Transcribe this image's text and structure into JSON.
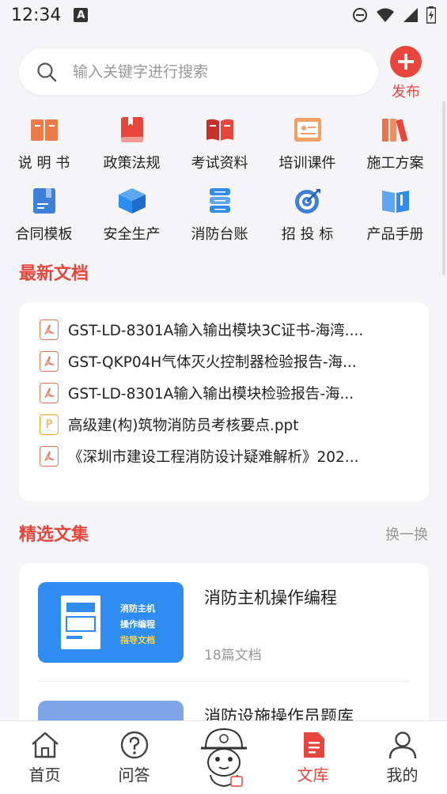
{
  "status": {
    "time": "12:34",
    "badge": "A"
  },
  "search": {
    "placeholder": "输入关键字进行搜索"
  },
  "publish": {
    "label": "发布"
  },
  "categories": [
    {
      "label": "说 明 书",
      "icon": "book-icon"
    },
    {
      "label": "政策法规",
      "icon": "bookmark-book-icon"
    },
    {
      "label": "考试资料",
      "icon": "open-book-icon"
    },
    {
      "label": "培训课件",
      "icon": "presentation-icon"
    },
    {
      "label": "施工方案",
      "icon": "binders-icon"
    },
    {
      "label": "合同模板",
      "icon": "contract-icon"
    },
    {
      "label": "安全生产",
      "icon": "box-icon"
    },
    {
      "label": "消防台账",
      "icon": "stack-icon"
    },
    {
      "label": "招 投 标",
      "icon": "target-icon"
    },
    {
      "label": "产品手册",
      "icon": "manual-icon"
    }
  ],
  "latest": {
    "title": "最新文档",
    "docs": [
      {
        "title": "GST-LD-8301A输入输出模块3C证书-海湾....",
        "type": "pdf"
      },
      {
        "title": "GST-QKP04H气体灭火控制器检验报告-海...",
        "type": "pdf"
      },
      {
        "title": "GST-LD-8301A输入输出模块检验报告-海...",
        "type": "pdf"
      },
      {
        "title": "高级建(构)筑物消防员考核要点.ppt",
        "type": "ppt"
      },
      {
        "title": "《深圳市建设工程消防设计疑难解析》202...",
        "type": "pdf"
      }
    ]
  },
  "featured": {
    "title": "精选文集",
    "refresh": "换一换",
    "items": [
      {
        "name": "消防主机操作编程",
        "count": "18篇文档",
        "cover_lines": [
          "消防主机",
          "操作编程",
          "指导文档"
        ]
      },
      {
        "name": "消防设施操作员题库"
      }
    ]
  },
  "tabs": [
    {
      "label": "首页",
      "icon": "home-icon"
    },
    {
      "label": "问答",
      "icon": "question-icon"
    },
    {
      "label": "",
      "icon": "mascot-icon"
    },
    {
      "label": "文库",
      "icon": "document-icon",
      "active": true
    },
    {
      "label": "我的",
      "icon": "user-icon"
    }
  ],
  "colors": {
    "accent": "#e8453c",
    "blue": "#2f8cf0",
    "orange": "#e8734c"
  }
}
